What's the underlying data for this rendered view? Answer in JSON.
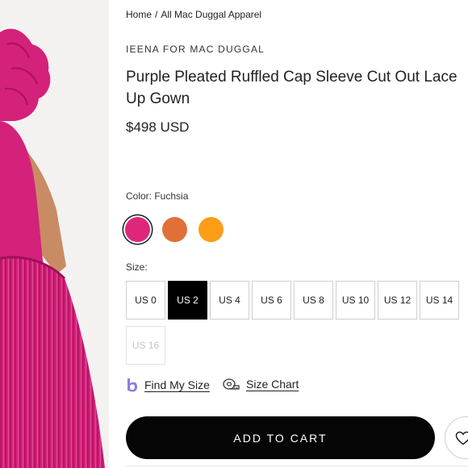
{
  "breadcrumb": {
    "home": "Home",
    "separator": "/",
    "current": "All Mac Duggal Apparel"
  },
  "product": {
    "brand": "IEENA FOR MAC DUGGAL",
    "title": "Purple Pleated Ruffled Cap Sleeve Cut Out Lace Up Gown",
    "price": "$498 USD"
  },
  "color": {
    "label": "Color: Fuchsia",
    "options": [
      {
        "name": "Fuchsia",
        "hex": "#e0267c",
        "selected": true
      },
      {
        "name": "Orange",
        "hex": "#e07038",
        "selected": false
      },
      {
        "name": "Yellow",
        "hex": "#ff9d17",
        "selected": false
      }
    ]
  },
  "size": {
    "label": "Size:",
    "options": [
      "US 0",
      "US 2",
      "US 4",
      "US 6",
      "US 8",
      "US 10",
      "US 12",
      "US 14",
      "US 16"
    ],
    "selected": "US 2",
    "unavailable": [
      "US 16"
    ]
  },
  "helpers": {
    "find_my_size": "Find My Size",
    "size_chart": "Size Chart"
  },
  "actions": {
    "add_to_cart": "ADD TO CART"
  },
  "icons": {
    "find_my_size": "bold-b-icon",
    "size_chart": "tape-measure-icon",
    "wishlist": "heart-icon"
  },
  "colors": {
    "accent": "#050505",
    "dress": "#d4217a"
  }
}
